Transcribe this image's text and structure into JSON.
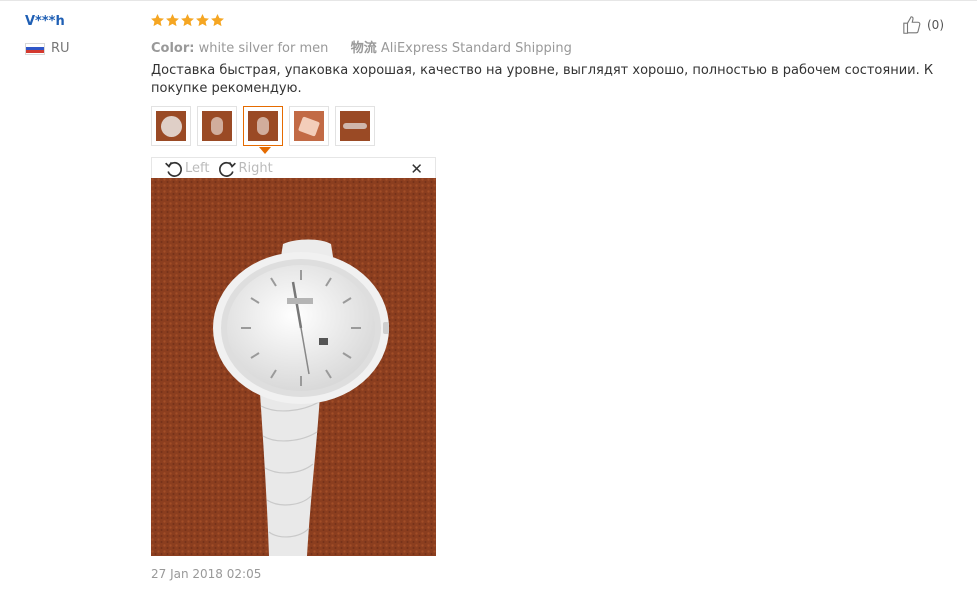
{
  "user": {
    "name": "V***h",
    "country": "RU",
    "flag_icon": "russia-flag-icon"
  },
  "rating": {
    "stars": 5,
    "color": "#f5a623"
  },
  "like": {
    "count": "(0)",
    "icon": "thumbs-up-icon"
  },
  "meta": {
    "color_label": "Color:",
    "color_value": "white silver for men",
    "shipping_label": "物流",
    "shipping_value": "AliExpress Standard Shipping"
  },
  "review_text": "Доставка быстрая, упаковка хорошая, качество на уровне, выглядят хорошо, полностью в рабочем состоянии. К покупке рекомендую.",
  "thumbnails": [
    {
      "icon": "photo-thumbnail",
      "active": false
    },
    {
      "icon": "photo-thumbnail",
      "active": false
    },
    {
      "icon": "photo-thumbnail",
      "active": true
    },
    {
      "icon": "photo-thumbnail",
      "active": false
    },
    {
      "icon": "photo-thumbnail",
      "active": false
    }
  ],
  "viewer": {
    "rotate_left_label": "Left",
    "rotate_right_label": "Right",
    "close_icon": "close-icon"
  },
  "colors": {
    "accent": "#e56b00",
    "username": "#1f5fb4",
    "background_photo": "#8b3e1f"
  },
  "date": "27 Jan 2018 02:05"
}
